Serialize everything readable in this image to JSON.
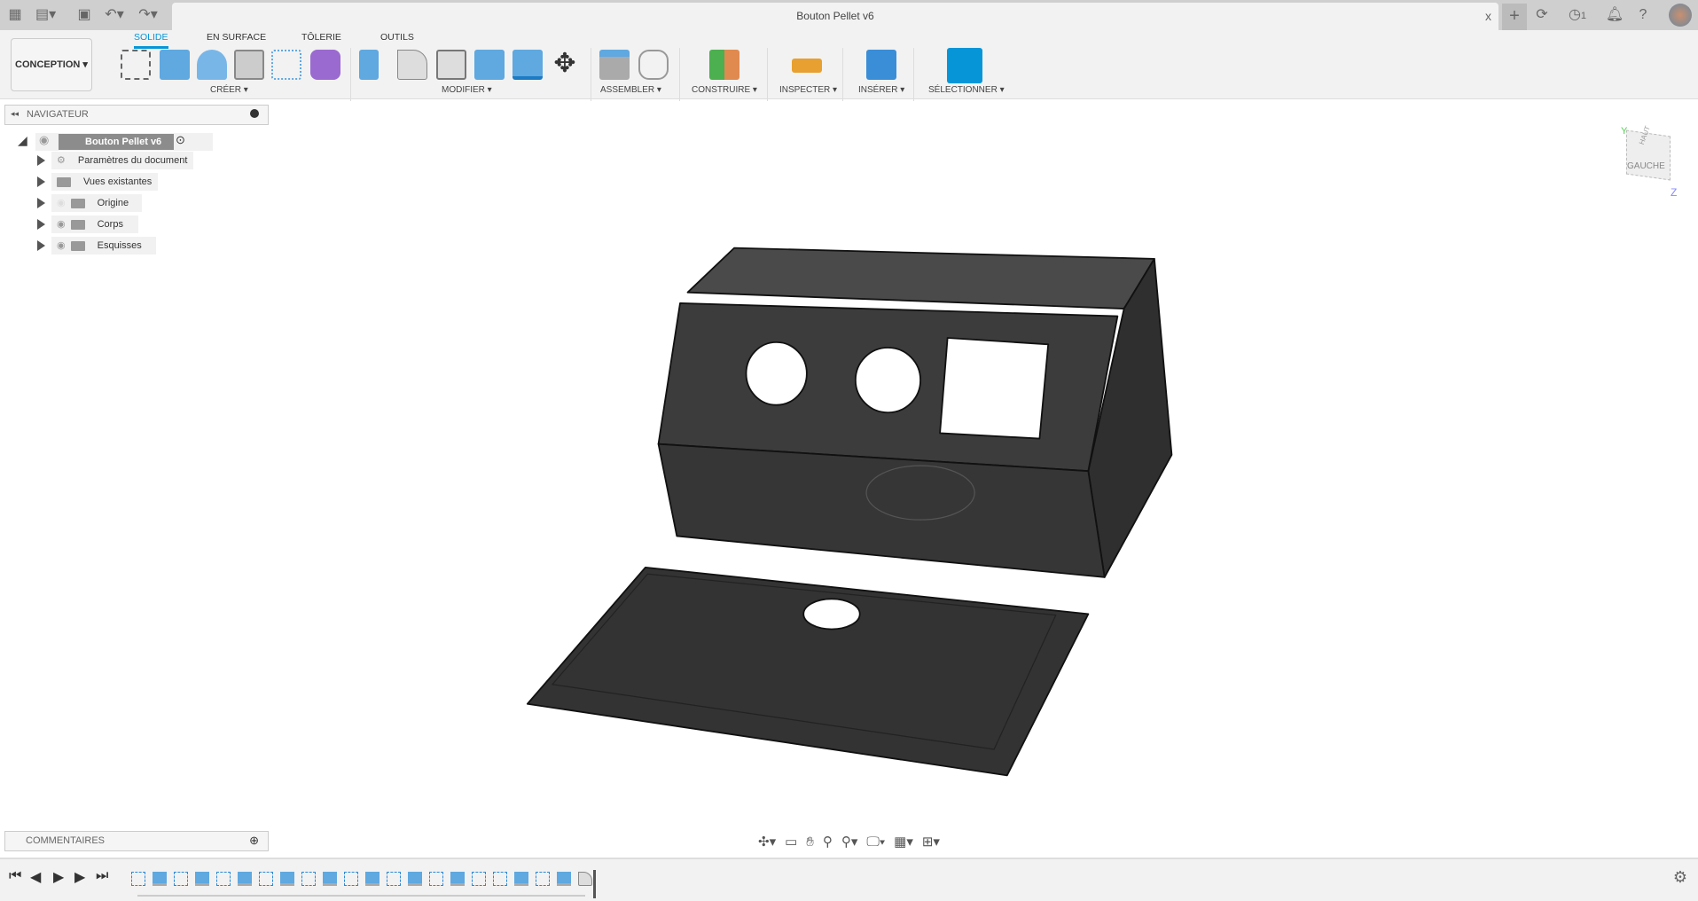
{
  "window": {
    "title": "Bouton Pellet v6",
    "close": "x",
    "notifications_count": "1"
  },
  "toolbar": {
    "workspace": "CONCEPTION",
    "tabs": [
      {
        "label": "SOLIDE",
        "active": true
      },
      {
        "label": "EN SURFACE"
      },
      {
        "label": "TÔLERIE"
      },
      {
        "label": "OUTILS"
      }
    ],
    "groups": [
      "CRÉER",
      "MODIFIER",
      "ASSEMBLER",
      "CONSTRUIRE",
      "INSPECTER",
      "INSÉRER",
      "SÉLECTIONNER"
    ]
  },
  "navigator": {
    "title": "NAVIGATEUR",
    "root": "Bouton Pellet v6",
    "items": [
      {
        "label": "Paramètres du document",
        "icon": "gear-icon"
      },
      {
        "label": "Vues existantes",
        "icon": "folder-icon"
      },
      {
        "label": "Origine",
        "icon": "folder-icon",
        "hidden": true
      },
      {
        "label": "Corps",
        "icon": "folder-icon"
      },
      {
        "label": "Esquisses",
        "icon": "folder-icon"
      }
    ]
  },
  "comments": {
    "title": "COMMENTAIRES"
  },
  "viewcube": {
    "face": "GAUCHE",
    "top": "HAUT",
    "axis_y": "Y",
    "axis_z": "Z"
  },
  "timeline": {
    "features": [
      "sketch",
      "extrude",
      "sketch",
      "extrude",
      "sketch",
      "extrude",
      "sketch",
      "extrude",
      "sketch",
      "extrude",
      "sketch",
      "extrude",
      "sketch",
      "extrude",
      "sketch",
      "extrude",
      "sketch",
      "sketch",
      "extrude",
      "sketch",
      "extrude",
      "fillet"
    ]
  },
  "colors": {
    "accent": "#0696d7",
    "model": "#3a3a3a"
  }
}
